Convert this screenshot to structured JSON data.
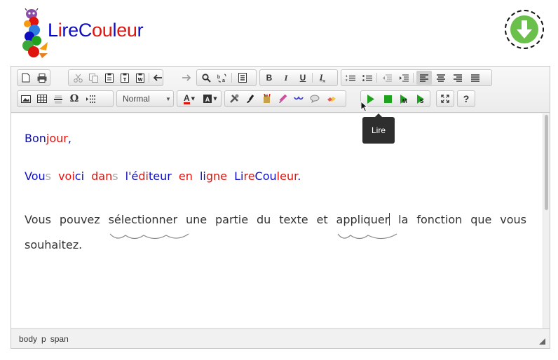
{
  "app": {
    "title_parts": [
      {
        "text": "L",
        "color": "#0000cc"
      },
      {
        "text": "i",
        "color": "#e0140e"
      },
      {
        "text": "re",
        "color": "#0d0dbf"
      },
      {
        "text": "C",
        "color": "#0d0dbf"
      },
      {
        "text": "ou",
        "color": "#e0140e"
      },
      {
        "text": "l",
        "color": "#0d0dbf"
      },
      {
        "text": "eu",
        "color": "#e0140e"
      },
      {
        "text": "r",
        "color": "#0d0dbf"
      }
    ],
    "logo_icon": "caterpillar-logo",
    "download_icon": "download-arrow-icon"
  },
  "toolbar": {
    "format_select": "Normal",
    "text_color_label": "A",
    "help_label": "?"
  },
  "tooltip": {
    "text": "Lire"
  },
  "content": {
    "p1": [
      {
        "t": "Bon",
        "c": "b"
      },
      {
        "t": "jour",
        "c": "r"
      },
      {
        "t": ",",
        "c": "b"
      }
    ],
    "p2": [
      {
        "t": "Vou",
        "c": "b"
      },
      {
        "t": "s",
        "c": "g"
      },
      {
        "t": " ",
        "c": "k"
      },
      {
        "t": "voi",
        "c": "r"
      },
      {
        "t": "ci",
        "c": "b"
      },
      {
        "t": " ",
        "c": "k"
      },
      {
        "t": "dan",
        "c": "r"
      },
      {
        "t": "s",
        "c": "g"
      },
      {
        "t": " ",
        "c": "k"
      },
      {
        "t": "l'",
        "c": "b"
      },
      {
        "t": "é",
        "c": "b"
      },
      {
        "t": "di",
        "c": "r"
      },
      {
        "t": "teur",
        "c": "b"
      },
      {
        "t": " ",
        "c": "k"
      },
      {
        "t": "en",
        "c": "r"
      },
      {
        "t": " ",
        "c": "k"
      },
      {
        "t": "li",
        "c": "b"
      },
      {
        "t": "gne",
        "c": "r"
      },
      {
        "t": " ",
        "c": "k"
      },
      {
        "t": "Li",
        "c": "b"
      },
      {
        "t": "re",
        "c": "r"
      },
      {
        "t": "Cou",
        "c": "b"
      },
      {
        "t": "leur",
        "c": "r"
      },
      {
        "t": ".",
        "c": "b"
      }
    ],
    "p3_a": "Vous pouvez ",
    "p3_word1": "sélectionner",
    "p3_b": " une partie du texte et ",
    "p3_word2": "appliquer",
    "p3_c": " la fonction que vous souhaitez."
  },
  "statusbar": {
    "path": [
      "body",
      "p",
      "span"
    ]
  },
  "colors": {
    "blue": "#0d0dbf",
    "red": "#e0140e",
    "green_play": "#1fa31f",
    "download_green": "#6bc04b"
  }
}
